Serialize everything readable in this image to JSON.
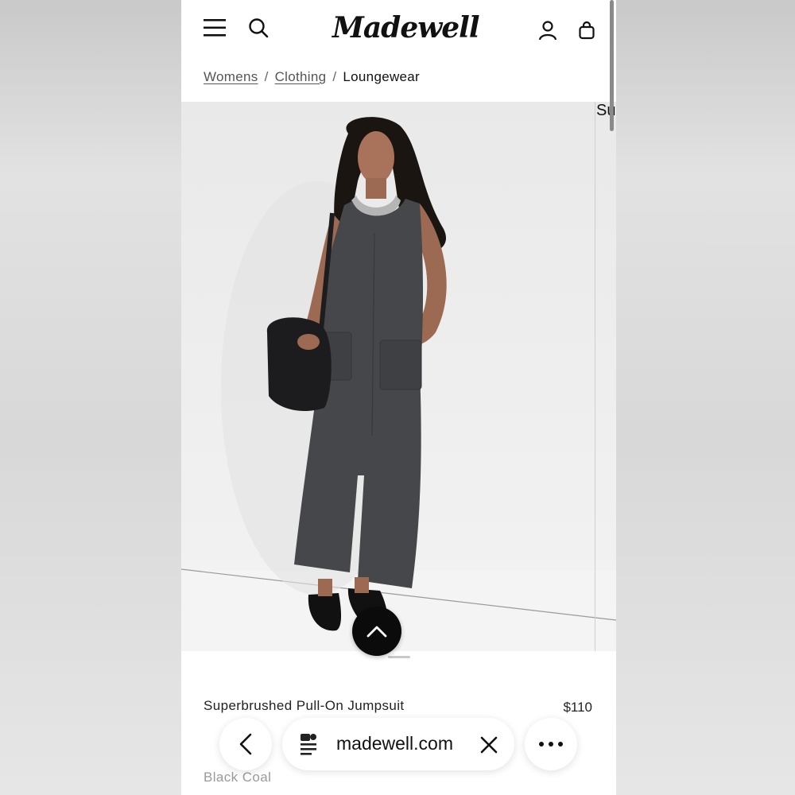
{
  "header": {
    "logo_text": "Madewell",
    "icons": [
      "menu-icon",
      "search-icon",
      "account-icon",
      "shopping-bag-icon"
    ]
  },
  "breadcrumb": {
    "items": [
      {
        "label": "Womens"
      },
      {
        "label": "Clothing"
      },
      {
        "label": "Loungewear"
      }
    ],
    "separator": "/"
  },
  "gallery": {
    "next_slide_label": "Su"
  },
  "product": {
    "name": "Superbrushed Pull-On Jumpsuit",
    "price": "$110",
    "color": "Black Coal"
  },
  "browser": {
    "url": "madewell.com",
    "icons": [
      "back-arrow-icon",
      "reader-icon",
      "close-icon",
      "more-icon"
    ]
  },
  "colors": {
    "accent": "#0b0b0b",
    "background": "#ffffff",
    "jumpsuit": "#46474a"
  }
}
